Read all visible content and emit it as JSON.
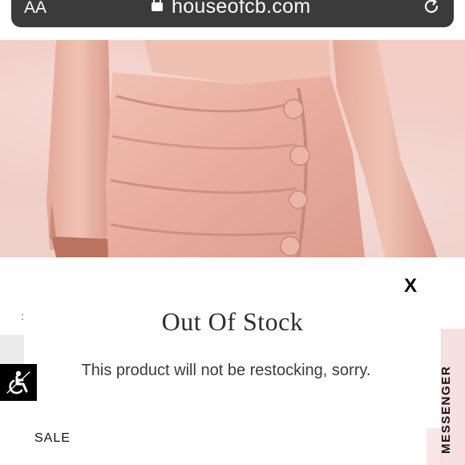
{
  "browser": {
    "text_size_label": "AA",
    "domain": "houseofcb.com"
  },
  "modal": {
    "close_label": "X",
    "title": "Out Of Stock",
    "message": "This product will not be restocking, sorry."
  },
  "page": {
    "left_fragment": ":",
    "sale_label": "SALE",
    "messenger_label": "MESSENGER"
  },
  "colors": {
    "product_pink": "#e9b3a6",
    "url_bar": "#3b3b3b",
    "messenger_tab": "#f7e1e0"
  },
  "icons": {
    "lock": "lock-icon",
    "reload": "reload-icon",
    "accessibility": "accessibility-icon"
  }
}
